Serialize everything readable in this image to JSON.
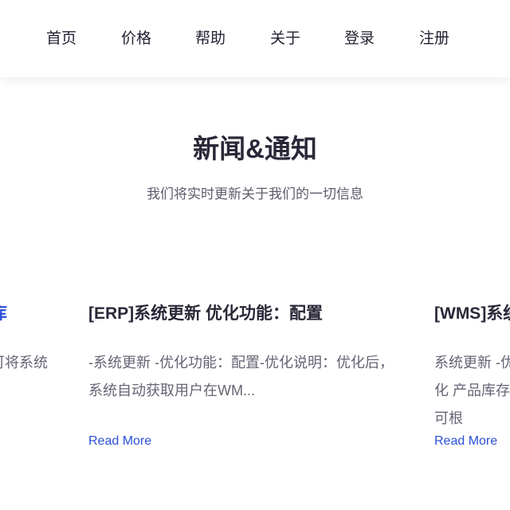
{
  "nav": {
    "items": [
      {
        "label": "首页"
      },
      {
        "label": "价格"
      },
      {
        "label": "帮助"
      },
      {
        "label": "关于"
      },
      {
        "label": "登录"
      },
      {
        "label": "注册"
      }
    ]
  },
  "section": {
    "title": "新闻&通知",
    "subtitle": "我们将实时更新关于我们的一切信息"
  },
  "cards": [
    {
      "title": "库",
      "body": "可将系统",
      "read_more": "Read More"
    },
    {
      "title": "[ERP]系统更新 优化功能：配置",
      "body": "-系统更新 -优化功能：配置-优化说明：优化后，系统自动获取用户在WM...",
      "read_more": "Read More"
    },
    {
      "title": "[WMS]系统",
      "body": "系统更新 -优化 产品库存可根",
      "read_more": "Read More"
    }
  ],
  "colors": {
    "accent": "#2a4fd8",
    "heading": "#2a2838",
    "text": "#666474"
  }
}
